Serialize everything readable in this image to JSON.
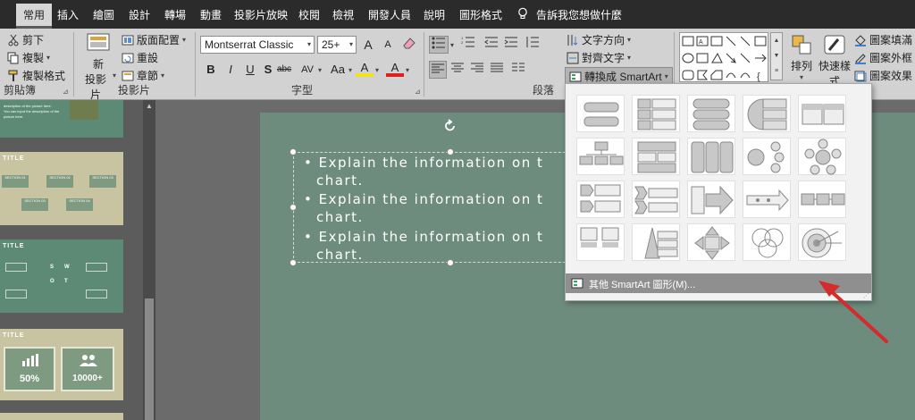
{
  "tabs": [
    "常用",
    "插入",
    "繪圖",
    "設計",
    "轉場",
    "動畫",
    "投影片放映",
    "校閱",
    "檢視",
    "開發人員",
    "說明",
    "圖形格式"
  ],
  "tell_me": "告訴我您想做什麼",
  "clipboard": {
    "cut": "剪下",
    "copy": "複製",
    "format_painter": "複製格式",
    "label": "剪貼簿"
  },
  "slides": {
    "new_slide_line1": "新",
    "new_slide_line2": "投影片",
    "layout": "版面配置",
    "reset": "重設",
    "section": "章節",
    "label": "投影片"
  },
  "font": {
    "name": "Montserrat Classic",
    "size": "25+",
    "grow": "A",
    "shrink": "A",
    "bold": "B",
    "italic": "I",
    "underline": "U",
    "shadow": "S",
    "strike": "abc",
    "spacing": "AV",
    "case": "Aa",
    "highlight": "A",
    "color": "A",
    "label": "字型"
  },
  "paragraph": {
    "text_direction": "文字方向",
    "align_text": "對齊文字",
    "convert_smartart": "轉換成 SmartArt",
    "label": "段落"
  },
  "drawing": {
    "arrange": "排列",
    "quick_styles_1": "快速樣",
    "quick_styles_2": "式",
    "shape_fill": "圖案填滿",
    "shape_outline": "圖案外框",
    "shape_effects": "圖案效果"
  },
  "smartart": {
    "more": "其他 SmartArt 圖形(M)..."
  },
  "thumbnails": {
    "thumb1_text": "description of the picture here.\nYou can input the description of the picture here.",
    "thumb2_title": "TITLE",
    "thumb2_sections": [
      "SECTION 01",
      "SECTION 02",
      "SECTION 03",
      "SECTION 03",
      "SECTION 04"
    ],
    "thumb3_title": "TITLE",
    "thumb3_swot": [
      "S",
      "W",
      "O",
      "T"
    ],
    "thumb4_title": "TITLE",
    "thumb4_stats": [
      "50%",
      "10000+"
    ]
  },
  "slide": {
    "bullets": [
      {
        "line1": "• Explain the information on t",
        "line2": "chart."
      },
      {
        "line1": "• Explain the information on t",
        "line2": "chart."
      },
      {
        "line1": "• Explain the information on t",
        "line2": "chart."
      }
    ]
  },
  "colors": {
    "slide_bg": "#6d8c7e",
    "thumb_green": "#5d8a74",
    "thumb_beige": "#c8c3a0",
    "arrow": "#d42b2b",
    "ribbon": "#d2d2d2"
  }
}
